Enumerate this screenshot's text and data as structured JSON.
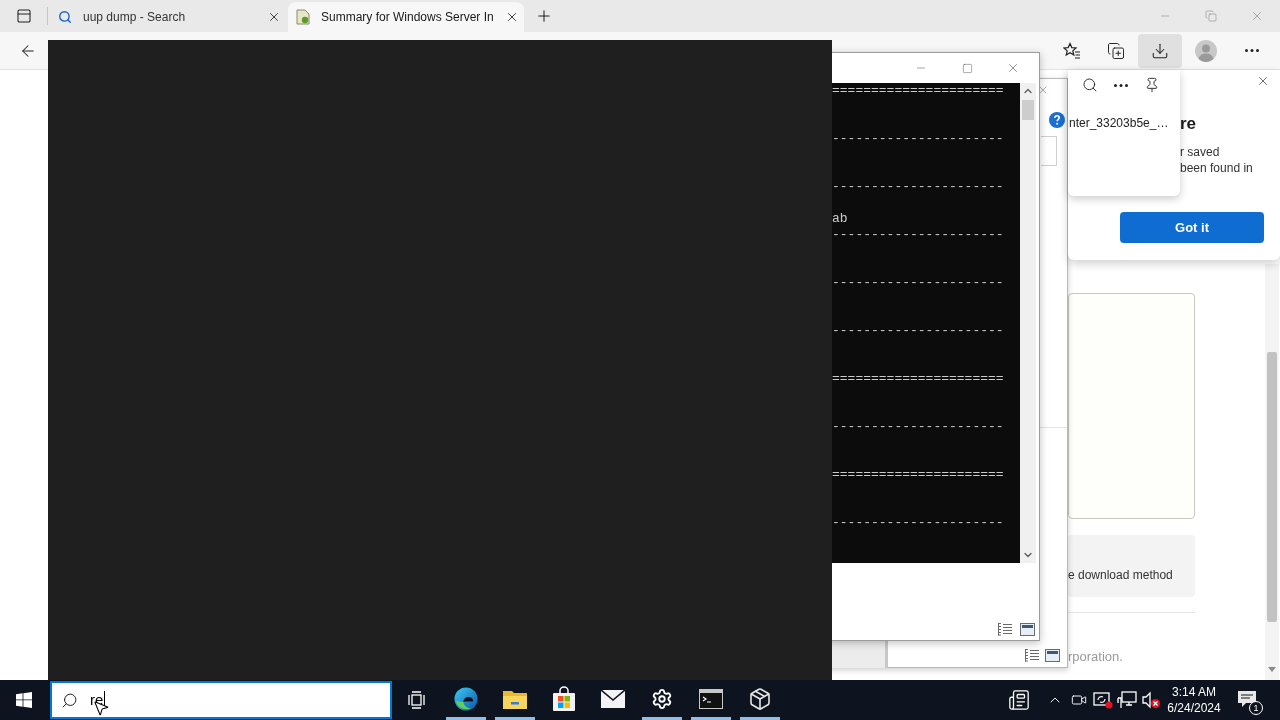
{
  "browser": {
    "tabs": [
      {
        "kind": "search",
        "title": "uup dump - Search",
        "selected": false
      },
      {
        "kind": "page",
        "title": "Summary for Windows Server In",
        "selected": true
      }
    ],
    "downloads_button": {
      "active": true
    }
  },
  "page": {
    "card_text": "e download method",
    "footer": "rporation."
  },
  "console_window": {
    "blocks": [
      {
        "rule": "======================"
      },
      {
        "rule": "----------------------"
      },
      {
        "rule": "----------------------",
        "text": "ab"
      },
      {
        "rule": "----------------------"
      },
      {
        "rule": "----------------------"
      },
      {
        "rule": "----------------------"
      },
      {
        "rule": "======================"
      },
      {
        "rule": "----------------------"
      },
      {
        "rule": "======================"
      },
      {
        "rule": "----------------------"
      }
    ]
  },
  "downloads_flyout": {
    "item": "nter_33203b5e_…"
  },
  "callout": {
    "title": "re",
    "lines": [
      "r saved",
      "been found in"
    ],
    "button": "Got it"
  },
  "taskbar": {
    "search": {
      "value": "re"
    },
    "apps": [
      {
        "kind": "edge",
        "running": true
      },
      {
        "kind": "explorer",
        "running": true
      },
      {
        "kind": "store",
        "running": false
      },
      {
        "kind": "mail",
        "running": false
      },
      {
        "kind": "settings",
        "running": true
      },
      {
        "kind": "terminal",
        "running": true
      },
      {
        "kind": "package",
        "running": true
      }
    ],
    "clock": {
      "time": "3:14 AM",
      "date": "6/24/2024"
    },
    "notification_count": "1"
  }
}
